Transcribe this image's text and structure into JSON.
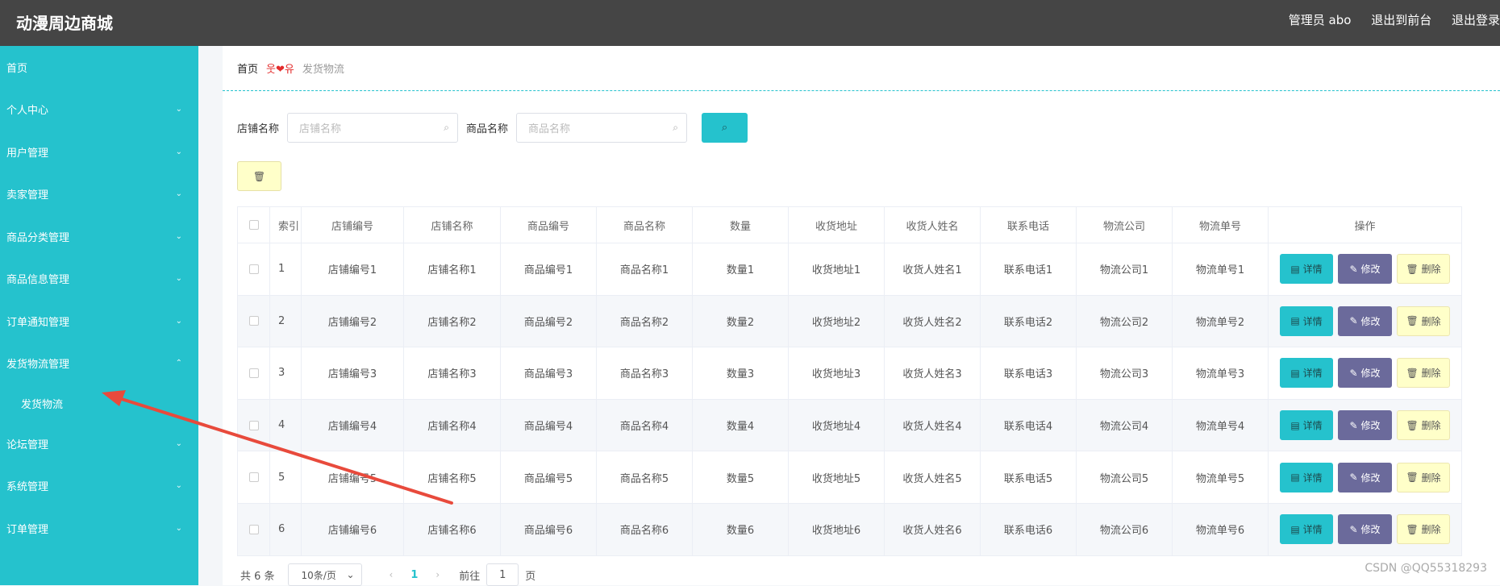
{
  "header": {
    "brand": "动漫周边商城",
    "admin": "管理员 abo",
    "front": "退出到前台",
    "logout": "退出登录"
  },
  "sidebar": {
    "items": [
      {
        "label": "首页",
        "chevron": ""
      },
      {
        "label": "个人中心",
        "chevron": "⌄"
      },
      {
        "label": "用户管理",
        "chevron": "⌄"
      },
      {
        "label": "卖家管理",
        "chevron": "⌄"
      },
      {
        "label": "商品分类管理",
        "chevron": "⌄"
      },
      {
        "label": "商品信息管理",
        "chevron": "⌄"
      },
      {
        "label": "订单通知管理",
        "chevron": "⌄"
      },
      {
        "label": "发货物流管理",
        "chevron": "⌃"
      }
    ],
    "sub_item": "发货物流",
    "items_after": [
      {
        "label": "论坛管理",
        "chevron": "⌄"
      },
      {
        "label": "系统管理",
        "chevron": "⌄"
      },
      {
        "label": "订单管理",
        "chevron": "⌄"
      }
    ]
  },
  "breadcrumb": {
    "home": "首页",
    "sep": "웃❤유",
    "current": "发货物流"
  },
  "search": {
    "shop_label": "店铺名称",
    "shop_placeholder": "店铺名称",
    "goods_label": "商品名称",
    "goods_placeholder": "商品名称",
    "search_icon": "⌕"
  },
  "delete_icon": "🗑",
  "table": {
    "headers": [
      "索引",
      "店铺编号",
      "店铺名称",
      "商品编号",
      "商品名称",
      "数量",
      "收货地址",
      "收货人姓名",
      "联系电话",
      "物流公司",
      "物流单号",
      "操作"
    ],
    "rows": [
      [
        "1",
        "店铺编号1",
        "店铺名称1",
        "商品编号1",
        "商品名称1",
        "数量1",
        "收货地址1",
        "收货人姓名1",
        "联系电话1",
        "物流公司1",
        "物流单号1"
      ],
      [
        "2",
        "店铺编号2",
        "店铺名称2",
        "商品编号2",
        "商品名称2",
        "数量2",
        "收货地址2",
        "收货人姓名2",
        "联系电话2",
        "物流公司2",
        "物流单号2"
      ],
      [
        "3",
        "店铺编号3",
        "店铺名称3",
        "商品编号3",
        "商品名称3",
        "数量3",
        "收货地址3",
        "收货人姓名3",
        "联系电话3",
        "物流公司3",
        "物流单号3"
      ],
      [
        "4",
        "店铺编号4",
        "店铺名称4",
        "商品编号4",
        "商品名称4",
        "数量4",
        "收货地址4",
        "收货人姓名4",
        "联系电话4",
        "物流公司4",
        "物流单号4"
      ],
      [
        "5",
        "店铺编号5",
        "店铺名称5",
        "商品编号5",
        "商品名称5",
        "数量5",
        "收货地址5",
        "收货人姓名5",
        "联系电话5",
        "物流公司5",
        "物流单号5"
      ],
      [
        "6",
        "店铺编号6",
        "店铺名称6",
        "商品编号6",
        "商品名称6",
        "数量6",
        "收货地址6",
        "收货人姓名6",
        "联系电话6",
        "物流公司6",
        "物流单号6"
      ]
    ],
    "actions": {
      "detail": "详情",
      "edit": "修改",
      "delete": "删除"
    }
  },
  "pagination": {
    "total": "共 6 条",
    "page_size": "10条/页",
    "current_page": "1",
    "goto_prefix": "前往",
    "goto_value": "1",
    "goto_suffix": "页"
  },
  "watermark": "CSDN @QQ55318293",
  "colors": {
    "accent": "#25c2cd",
    "header": "#454545",
    "edit": "#6b6a9b",
    "warn": "#ffffc9",
    "annotation": "#e84a3c"
  }
}
